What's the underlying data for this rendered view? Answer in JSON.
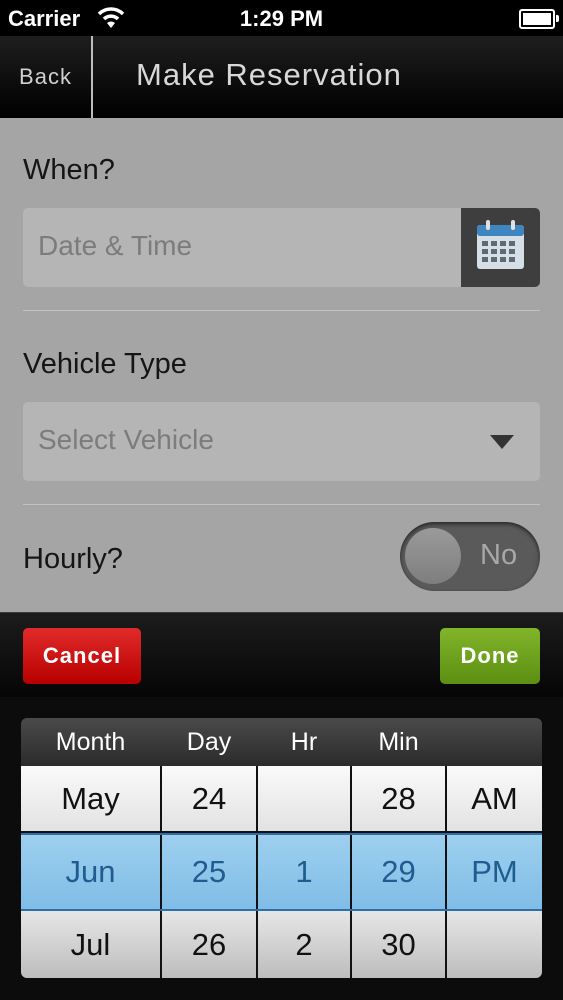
{
  "status_bar": {
    "carrier": "Carrier",
    "time": "1:29 PM"
  },
  "navbar": {
    "back_label": "Back",
    "title": "Make Reservation"
  },
  "form": {
    "when_label": "When?",
    "date_placeholder": "Date & Time",
    "vehicle_label": "Vehicle Type",
    "vehicle_placeholder": "Select Vehicle",
    "hourly_label": "Hourly?",
    "hourly_toggle_text": "No"
  },
  "toolbar": {
    "cancel_label": "Cancel",
    "done_label": "Done"
  },
  "picker": {
    "headers": [
      "Month",
      "Day",
      "Hr",
      "Min",
      ""
    ],
    "rows": [
      [
        "May",
        "24",
        "",
        "28",
        "AM"
      ],
      [
        "Jun",
        "25",
        "1",
        "29",
        "PM"
      ],
      [
        "Jul",
        "26",
        "2",
        "30",
        ""
      ]
    ],
    "selected_row": 1
  },
  "icons": {
    "wifi": "wifi-icon",
    "battery": "battery-icon",
    "calendar": "calendar-icon",
    "dropdown": "chevron-down-icon"
  },
  "colors": {
    "cancel": "#c81414",
    "done": "#6fa11e",
    "selection": "#8fc6ea"
  }
}
